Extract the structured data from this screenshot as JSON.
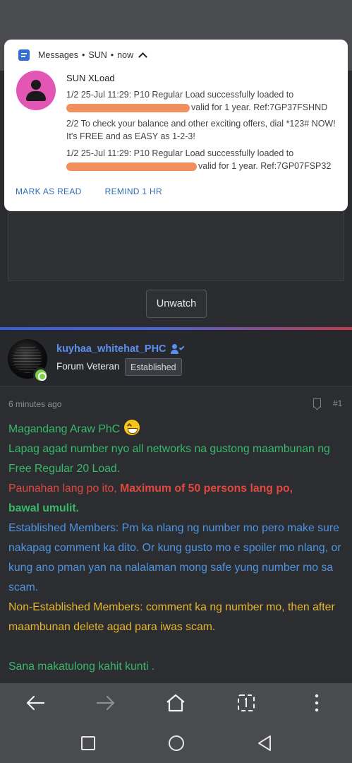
{
  "notification": {
    "app": "Messages",
    "source": "SUN",
    "time": "now",
    "sender": "SUN XLoad",
    "message1_start": "1/2 25-Jul 11:29: P10 Regular Load successfully loaded to",
    "message1_end": "valid for 1 year. Ref:7GP37FSHND",
    "message2": "2/2 To check your balance and other exciting offers, dial *123# NOW! It's FREE and as EASY as 1-2-3!",
    "message3_start": "1/2 25-Jul 11:29: P10 Regular Load successfully loaded to",
    "message3_end": "valid for 1 year. Ref:7GP07FSP32",
    "action_mark_read": "MARK AS READ",
    "action_remind": "REMIND 1 HR"
  },
  "page": {
    "unwatch_label": "Unwatch"
  },
  "post": {
    "username": "kuyhaa_whitehat_PHC",
    "user_title": "Forum Veteran",
    "badge": "Established",
    "time": "6 minutes ago",
    "number": "#1",
    "line1": "Magandang Araw PhC",
    "line2": "Lapag agad number nyo all networks na gustong maambunan ng Free Regular 20 Load.",
    "line3a": "Paunahan lang po ito, ",
    "line3b": "Maximum of 50 persons lang po,",
    "line3c": "bawal umulit.",
    "line4": "Established Members: Pm ka nlang ng number mo pero make sure nakapag comment ka dito. Or kung gusto mo e spoiler mo nlang, or kung ano pman yan na nalalaman mong safe yung number mo sa scam.",
    "line5": "Non-Established Members: comment ka ng number mo, then after maambunan delete agad para iwas scam.",
    "line6": "Sana makatulong kahit kunti ."
  },
  "icons": {
    "back": "arrow-left-icon",
    "forward": "arrow-right-icon",
    "home": "home-icon",
    "tabs": "tabs-icon",
    "menu": "more-vertical-icon"
  },
  "colors": {
    "username": "#5a8ff0",
    "green_text": "#39b86a",
    "red_text": "#e2483f",
    "blue_text": "#4f94e0",
    "yellow_text": "#e4b531",
    "notification_action": "#2f6db5"
  }
}
